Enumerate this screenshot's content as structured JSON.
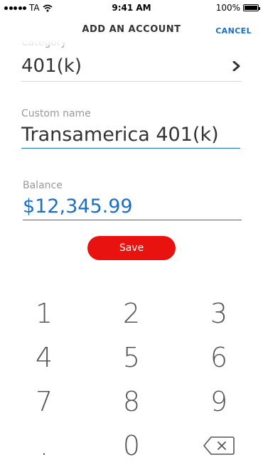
{
  "status_bar": {
    "carrier": "TA",
    "time": "9:41 AM",
    "battery": "100%"
  },
  "nav": {
    "title": "ADD AN ACCOUNT",
    "cancel_label": "CANCEL"
  },
  "category": {
    "label": "Category",
    "value": "401(k)",
    "chevron_icon": "chevron-right-icon"
  },
  "custom_name": {
    "label": "Custom name",
    "value": "Transamerica 401(k)"
  },
  "balance": {
    "label": "Balance",
    "value": "$12,345.99"
  },
  "save_label": "Save",
  "keypad": {
    "k1": "1",
    "k2": "2",
    "k3": "3",
    "k4": "4",
    "k5": "5",
    "k6": "6",
    "k7": "7",
    "k8": "8",
    "k9": "9",
    "dot": ".",
    "k0": "0",
    "delete_icon": "backspace-icon"
  },
  "colors": {
    "accent_blue": "#1a6fc9",
    "save_red": "#e8120f"
  }
}
